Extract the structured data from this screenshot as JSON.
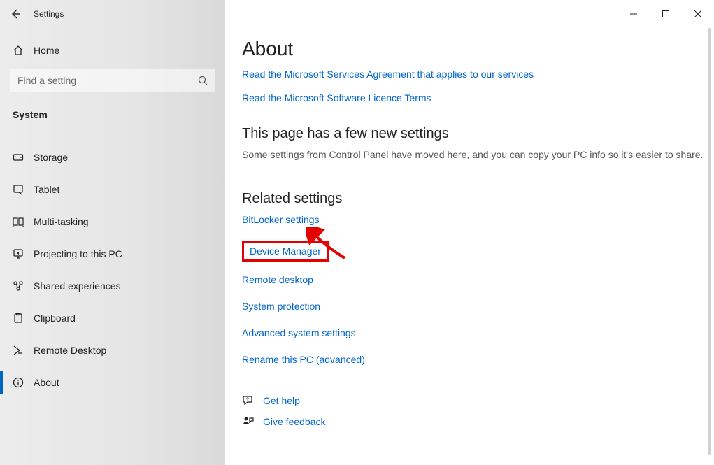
{
  "titlebar": {
    "app_name": "Settings"
  },
  "sidebar": {
    "home_label": "Home",
    "search_placeholder": "Find a setting",
    "section": "System",
    "items": [
      {
        "label": "Storage"
      },
      {
        "label": "Tablet"
      },
      {
        "label": "Multi-tasking"
      },
      {
        "label": "Projecting to this PC"
      },
      {
        "label": "Shared experiences"
      },
      {
        "label": "Clipboard"
      },
      {
        "label": "Remote Desktop"
      },
      {
        "label": "About",
        "selected": true
      }
    ]
  },
  "content": {
    "title": "About",
    "top_links": [
      "Read the Microsoft Services Agreement that applies to our services",
      "Read the Microsoft Software Licence Terms"
    ],
    "new_settings_heading": "This page has a few new settings",
    "new_settings_text": "Some settings from Control Panel have moved here, and you can copy your PC info so it's easier to share.",
    "related_heading": "Related settings",
    "related_links": [
      "BitLocker settings",
      "Device Manager",
      "Remote desktop",
      "System protection",
      "Advanced system settings",
      "Rename this PC (advanced)"
    ],
    "support": {
      "help": "Get help",
      "feedback": "Give feedback"
    }
  },
  "annotation": {
    "highlighted_link_index": 1
  }
}
